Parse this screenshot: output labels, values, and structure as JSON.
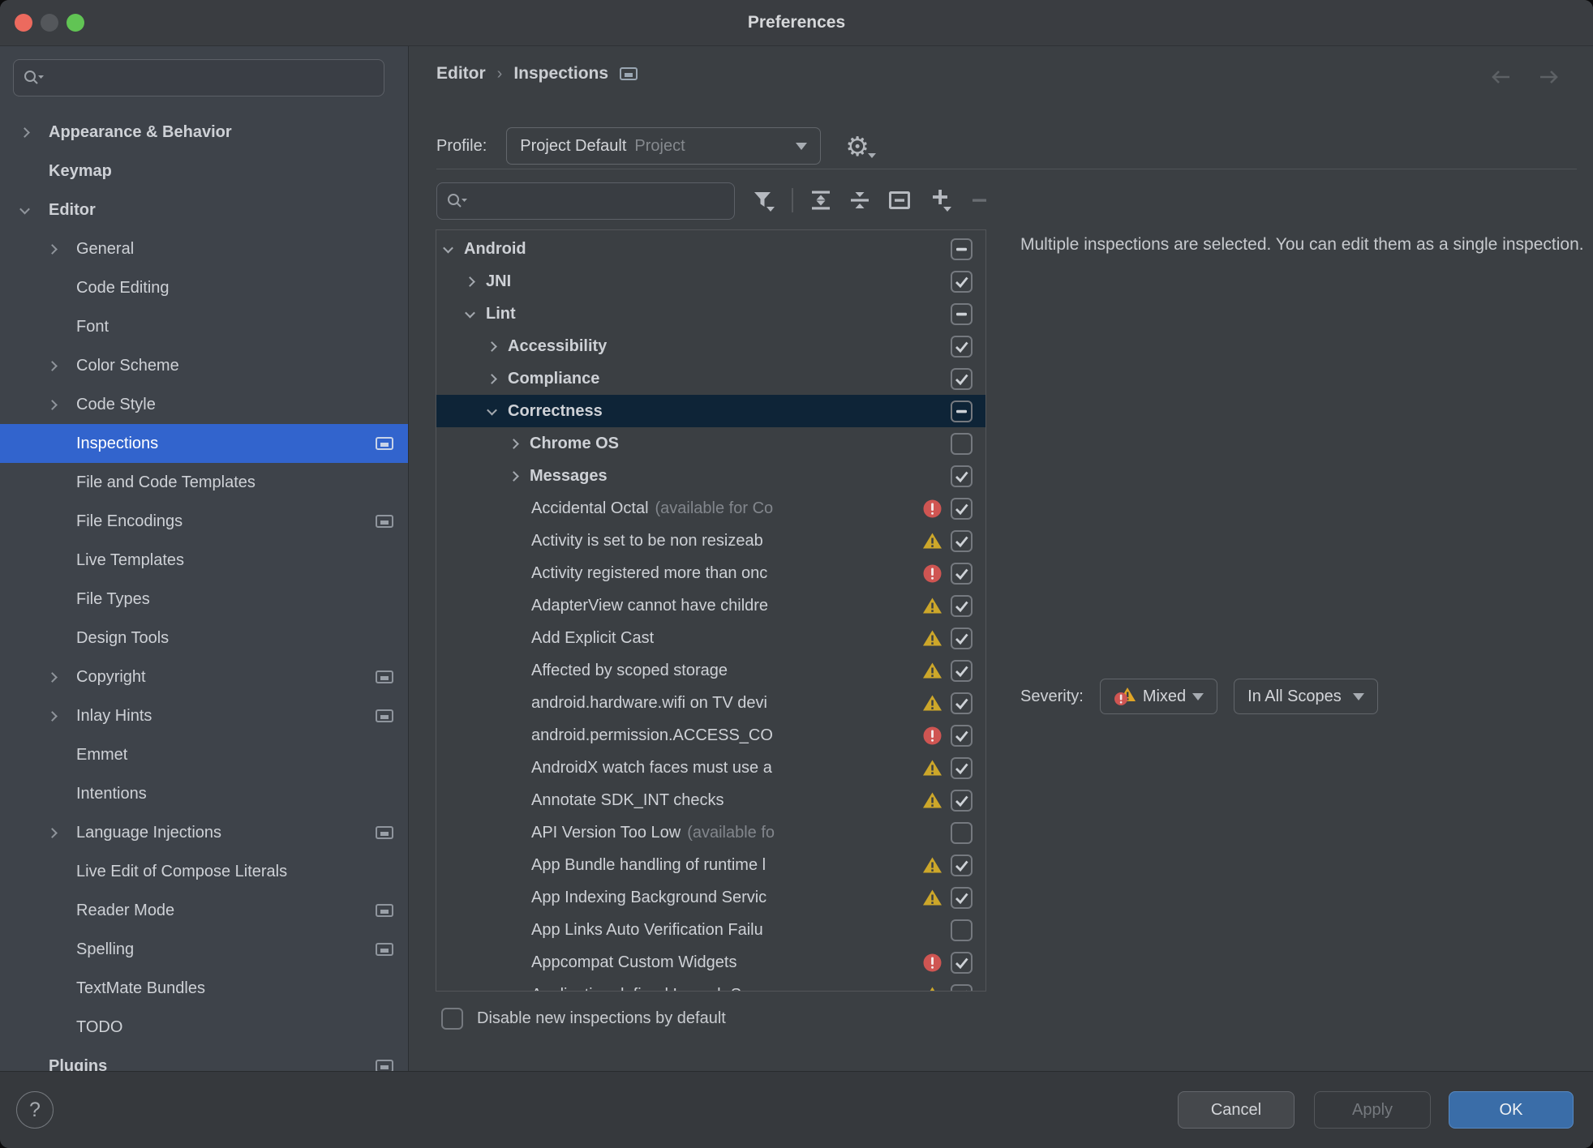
{
  "window": {
    "title": "Preferences"
  },
  "colors": {
    "sidebar_selection": "#3264cd",
    "tree_selection": "#0e2437",
    "ok_button": "#3a6da8",
    "error_red": "#cf5552",
    "warning_yellow": "#c9a227"
  },
  "icons": {
    "titlebar": [
      "close-light",
      "minimize-light",
      "zoom-light"
    ],
    "search": "magnifier-with-history-caret",
    "toolbar": [
      "filter-funnel",
      "expand-all",
      "collapse-all",
      "reset-box",
      "add-plus",
      "remove-minus"
    ],
    "profile": "gear-settings",
    "nav": [
      "arrow-back",
      "arrow-forward"
    ],
    "tree_status": [
      "error-circle",
      "warning-triangle"
    ],
    "sidebar_row_icon": "screen-icon",
    "help": "?"
  },
  "sidebar": {
    "search_placeholder": "",
    "items": [
      {
        "label": "Appearance & Behavior",
        "level": 0,
        "chevron": "right",
        "bold": true
      },
      {
        "label": "Keymap",
        "level": 0,
        "bold": true
      },
      {
        "label": "Editor",
        "level": 0,
        "chevron": "down",
        "bold": true
      },
      {
        "label": "General",
        "level": 1,
        "chevron": "right"
      },
      {
        "label": "Code Editing",
        "level": 1
      },
      {
        "label": "Font",
        "level": 1
      },
      {
        "label": "Color Scheme",
        "level": 1,
        "chevron": "right"
      },
      {
        "label": "Code Style",
        "level": 1,
        "chevron": "right"
      },
      {
        "label": "Inspections",
        "level": 1,
        "selected": true,
        "screen_icon": true
      },
      {
        "label": "File and Code Templates",
        "level": 1
      },
      {
        "label": "File Encodings",
        "level": 1,
        "screen_icon": true
      },
      {
        "label": "Live Templates",
        "level": 1
      },
      {
        "label": "File Types",
        "level": 1
      },
      {
        "label": "Design Tools",
        "level": 1
      },
      {
        "label": "Copyright",
        "level": 1,
        "chevron": "right",
        "screen_icon": true
      },
      {
        "label": "Inlay Hints",
        "level": 1,
        "chevron": "right",
        "screen_icon": true
      },
      {
        "label": "Emmet",
        "level": 1
      },
      {
        "label": "Intentions",
        "level": 1
      },
      {
        "label": "Language Injections",
        "level": 1,
        "chevron": "right",
        "screen_icon": true
      },
      {
        "label": "Live Edit of Compose Literals",
        "level": 1
      },
      {
        "label": "Reader Mode",
        "level": 1,
        "screen_icon": true
      },
      {
        "label": "Spelling",
        "level": 1,
        "screen_icon": true
      },
      {
        "label": "TextMate Bundles",
        "level": 1
      },
      {
        "label": "TODO",
        "level": 1
      },
      {
        "label": "Plugins",
        "level": 0,
        "bold": true,
        "screen_icon": true
      }
    ]
  },
  "breadcrumb": {
    "part1": "Editor",
    "separator": "›",
    "part2": "Inspections"
  },
  "profile": {
    "label": "Profile:",
    "value": "Project Default",
    "value_secondary": "Project"
  },
  "inspections": {
    "search_placeholder": "",
    "tree": [
      {
        "label": "Android",
        "level": 0,
        "chevron": "down",
        "bold": true,
        "check": "mixed"
      },
      {
        "label": "JNI",
        "level": 1,
        "chevron": "right",
        "bold": true,
        "check": "checked"
      },
      {
        "label": "Lint",
        "level": 1,
        "chevron": "down",
        "bold": true,
        "check": "mixed"
      },
      {
        "label": "Accessibility",
        "level": 2,
        "chevron": "right",
        "bold": true,
        "check": "checked"
      },
      {
        "label": "Compliance",
        "level": 2,
        "chevron": "right",
        "bold": true,
        "check": "checked"
      },
      {
        "label": "Correctness",
        "level": 2,
        "chevron": "down",
        "bold": true,
        "check": "mixed",
        "selected": true
      },
      {
        "label": "Chrome OS",
        "level": 3,
        "chevron": "right",
        "bold": true,
        "check": "unchecked"
      },
      {
        "label": "Messages",
        "level": 3,
        "chevron": "right",
        "bold": true,
        "check": "checked"
      },
      {
        "label": "Accidental Octal",
        "suffix": "(available for Co",
        "icon": "error",
        "check": "checked"
      },
      {
        "label": "Activity is set to be non resizeab",
        "icon": "warning",
        "check": "checked"
      },
      {
        "label": "Activity registered more than onc",
        "icon": "error",
        "check": "checked"
      },
      {
        "label": "AdapterView cannot have childre",
        "icon": "warning",
        "check": "checked"
      },
      {
        "label": "Add Explicit Cast",
        "icon": "warning",
        "check": "checked"
      },
      {
        "label": "Affected by scoped storage",
        "icon": "warning",
        "check": "checked"
      },
      {
        "label": "android.hardware.wifi on TV devi",
        "icon": "warning",
        "check": "checked"
      },
      {
        "label": "android.permission.ACCESS_CO",
        "icon": "error",
        "check": "checked"
      },
      {
        "label": "AndroidX watch faces must use a",
        "icon": "warning",
        "check": "checked"
      },
      {
        "label": "Annotate SDK_INT checks",
        "icon": "warning",
        "check": "checked"
      },
      {
        "label": "API Version Too Low",
        "suffix": "(available fo",
        "check": "unchecked"
      },
      {
        "label": "App Bundle handling of runtime l",
        "icon": "warning",
        "check": "checked"
      },
      {
        "label": "App Indexing Background Servic",
        "icon": "warning",
        "check": "checked"
      },
      {
        "label": "App Links Auto Verification Failu",
        "check": "unchecked"
      },
      {
        "label": "Appcompat Custom Widgets",
        "icon": "error",
        "check": "checked"
      },
      {
        "label": "Application defined Launch S",
        "icon": "warning",
        "check": "checked"
      }
    ],
    "disable_label": "Disable new inspections by default"
  },
  "details": {
    "message": "Multiple inspections are selected. You can edit them as a single inspection."
  },
  "severity": {
    "label": "Severity:",
    "value": "Mixed",
    "scope": "In All Scopes"
  },
  "footer": {
    "help": "?",
    "cancel": "Cancel",
    "apply": "Apply",
    "ok": "OK"
  }
}
